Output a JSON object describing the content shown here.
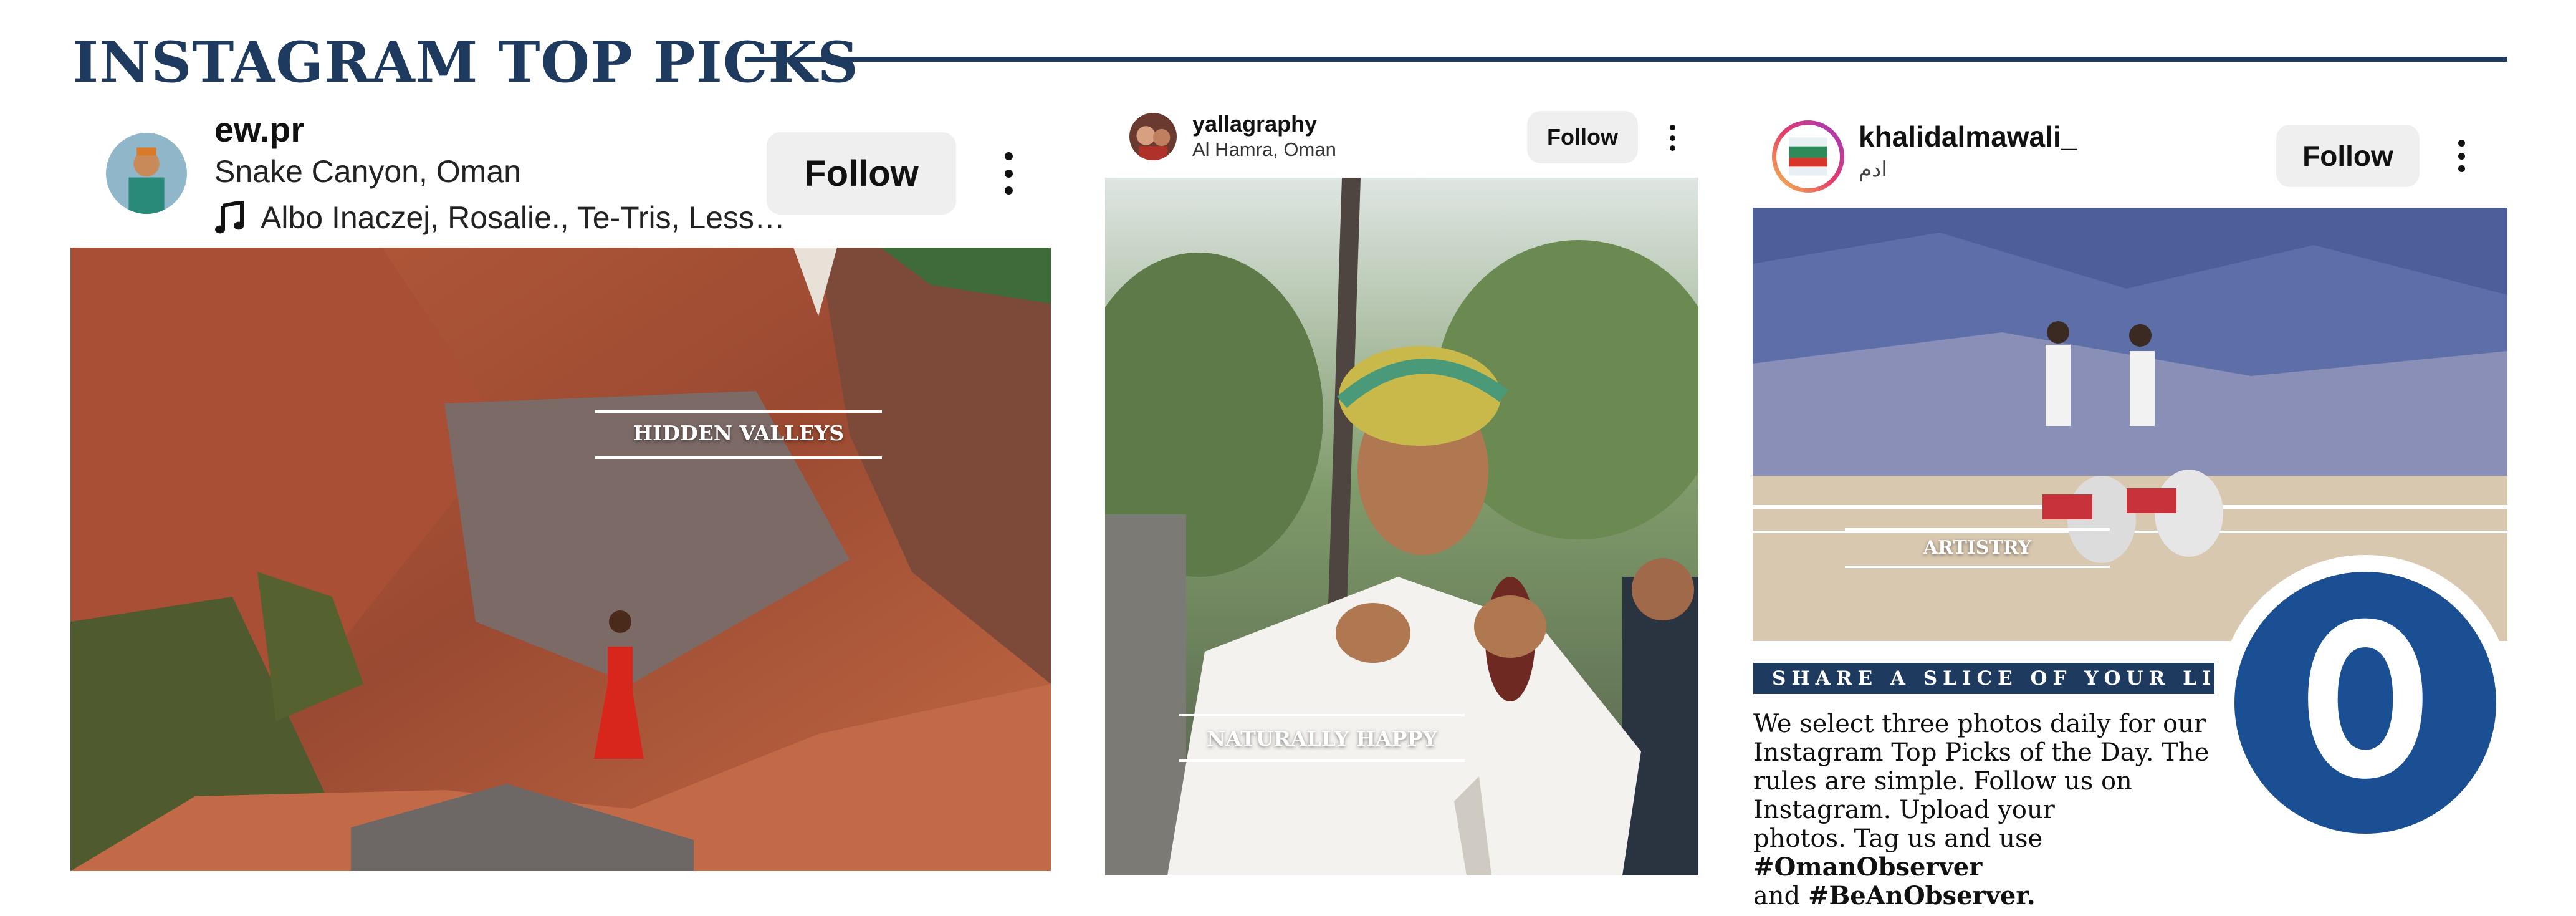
{
  "headline": "INSTAGRAM TOP PICKS",
  "posts": [
    {
      "username": "ew.pr",
      "location": "Snake Canyon, Oman",
      "audio": "Albo Inaczej, Rosalie., Te-Tris, Less…",
      "follow_label": "Follow",
      "photo_caption": "HIDDEN VALLEYS"
    },
    {
      "username": "yallagraphy",
      "location": "Al Hamra, Oman",
      "follow_label": "Follow",
      "photo_caption": "NATURALLY HAPPY"
    },
    {
      "username": "khalidalmawali_",
      "location": "ادم",
      "follow_label": "Follow",
      "photo_caption": "ARTISTRY"
    }
  ],
  "promo": {
    "banner": "SHARE A SLICE OF YOUR LIFE",
    "text_parts": {
      "line1": "We select three photos daily for our",
      "line2": "Instagram Top Picks of the Day. The",
      "line3": "rules are simple. Follow us on",
      "line4": "Instagram. Upload your",
      "line5": "photos. Tag us and use ",
      "hashtag1": "#OmanObserver",
      "line6": "and ",
      "hashtag2": "#BeAnObserver."
    },
    "logo_letter": "O"
  },
  "colors": {
    "brand_navy": "#1e3a5f",
    "logo_blue": "#1a4f93",
    "button_gray": "#efefef"
  },
  "icons": [
    "music-note-icon",
    "more-options-icon"
  ]
}
